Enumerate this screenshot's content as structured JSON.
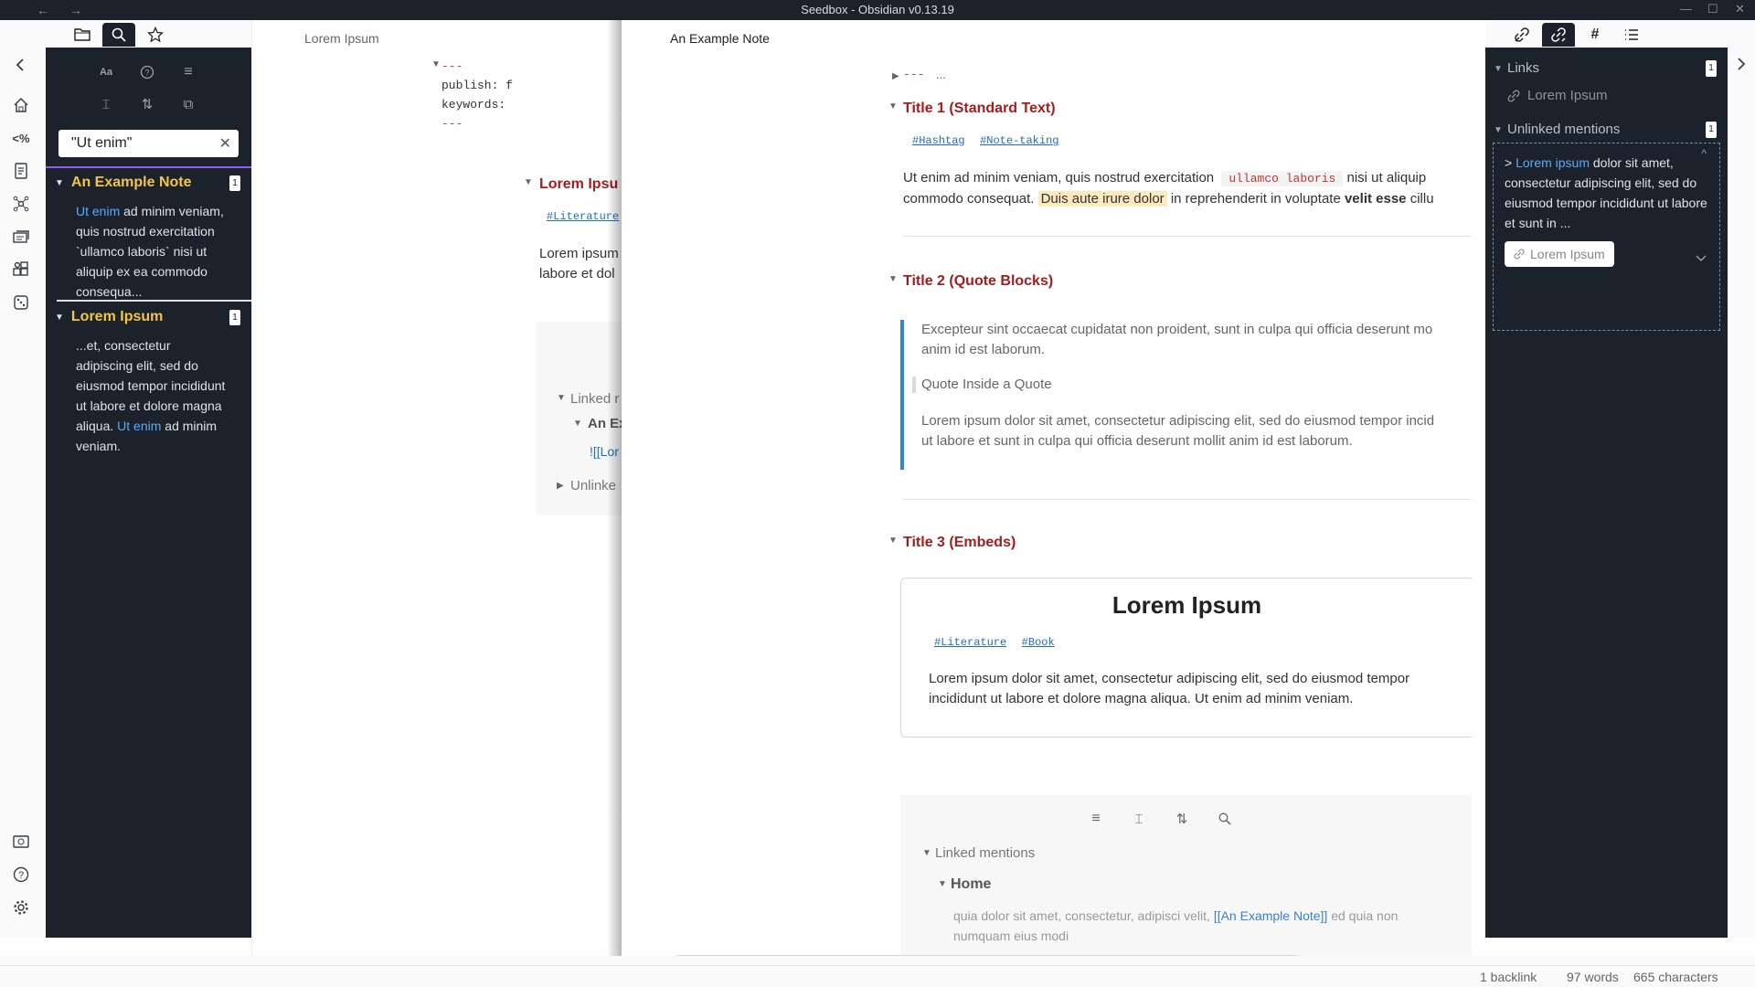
{
  "window": {
    "title": "Seedbox - Obsidian v0.13.19",
    "back": "←",
    "forward": "→"
  },
  "ribbon": {
    "top_icons": [
      "chevron-left-icon",
      "home-icon",
      "percent-code-icon",
      "document-list-icon",
      "graph-icon",
      "cards-icon",
      "puzzle-icon",
      "dice-icon"
    ],
    "bottom_icons": [
      "vault-icon",
      "help-icon",
      "settings-icon"
    ]
  },
  "left_sidebar": {
    "tabs": [
      "folder-icon",
      "search-icon",
      "star-icon"
    ],
    "search": {
      "value": "\"Ut enim\"",
      "clear": "✕"
    },
    "options": {
      "match_case": "Aa",
      "explain": "?",
      "collapse_results": "≡",
      "show_more_context": "⌶",
      "sort": "⇅",
      "copy_results": "⧉"
    },
    "results": [
      {
        "file": "An Example Note",
        "count": "1",
        "snippet_highlight": "Ut enim",
        "snippet_rest": " ad minim veniam, quis nostrud exercitation `ullamco laboris` nisi ut aliquip ex ea commodo consequa..."
      },
      {
        "file": "Lorem Ipsum",
        "count": "1",
        "snippet_before": "...et, consectetur adipiscing elit, sed do eiusmod tempor incididunt ut labore et dolore magna aliqua. ",
        "snippet_highlight": "Ut enim",
        "snippet_after": " ad minim veniam."
      }
    ]
  },
  "pane_left": {
    "title": "Lorem Ipsum",
    "frontmatter": [
      "---",
      "publish: f",
      "keywords:",
      "---"
    ],
    "heading": "Lorem Ipsu",
    "tag": "#Literature",
    "text_line1": "Lorem ipsum",
    "text_line2": "labore et dol",
    "backlinks": {
      "linked": "Linked r",
      "file": "An Ex",
      "embed": "![[Lor",
      "unlinked": "Unlinke"
    }
  },
  "pane_main": {
    "title": "An Example Note",
    "frontmatter_collapsed": "---",
    "frontmatter_ellipsis": "...",
    "sections": {
      "s1": {
        "heading": "Title 1 (Standard Text)",
        "tags": [
          "#Hashtag",
          "#Note-taking"
        ],
        "p_start": "Ut enim ad minim veniam, quis nostrud exercitation ",
        "code": "ullamco laboris",
        "p_mid": " nisi ut aliquip",
        "p2_start": "commodo consequat. ",
        "highlight": "Duis aute irure dolor",
        "p2_mid": " in reprehenderit in voluptate ",
        "bold": "velit esse",
        "p2_end": " cillu"
      },
      "s2": {
        "heading": "Title 2 (Quote Blocks)",
        "q1": "Excepteur sint occaecat cupidatat non proident, sunt in culpa qui officia deserunt mo",
        "q1b": "anim id est laborum.",
        "q_inner": "Quote Inside a Quote",
        "q2": "Lorem ipsum dolor sit amet, consectetur adipiscing elit, sed do eiusmod tempor incid",
        "q2b": "ut labore et sunt in culpa qui officia deserunt mollit anim id est laborum."
      },
      "s3": {
        "heading": "Title 3 (Embeds)",
        "embed_title": "Lorem Ipsum",
        "embed_tags": [
          "#Literature",
          "#Book"
        ],
        "embed_text1": "Lorem ipsum dolor sit amet, consectetur adipiscing elit, sed do eiusmod tempor",
        "embed_text2": "incididunt ut labore et dolore magna aliqua. Ut enim ad minim veniam."
      }
    },
    "backlinks": {
      "linked": "Linked mentions",
      "file": "Home",
      "context_before": "quia dolor sit amet, consectetur, adipisci velit, ",
      "context_link": "[[An Example Note]]",
      "context_after": " ed quia non",
      "context_line2": "numquam eius modi"
    }
  },
  "right_sidebar": {
    "tabs": [
      "backlinks-icon",
      "outgoing-links-icon",
      "tag-icon",
      "outline-icon"
    ],
    "links": {
      "label": "Links",
      "count": "1",
      "item": "Lorem Ipsum"
    },
    "unlinked": {
      "label": "Unlinked mentions",
      "count": "1",
      "prefix": "> ",
      "highlight": "Lorem ipsum",
      "text": " dolor sit amet, consectetur adipiscing elit, sed do eiusmod tempor incididunt ut labore et sunt in ...",
      "link_button": "Lorem Ipsum"
    }
  },
  "status": {
    "backlinks": "1 backlink",
    "words": "97 words",
    "characters": "665 characters"
  },
  "colors": {
    "dark": "#1b222b",
    "accent_red": "#a61c1c",
    "result_yellow": "#f5c542",
    "link_blue": "#5aa9ff",
    "quote_bar": "#3b7fd6"
  }
}
